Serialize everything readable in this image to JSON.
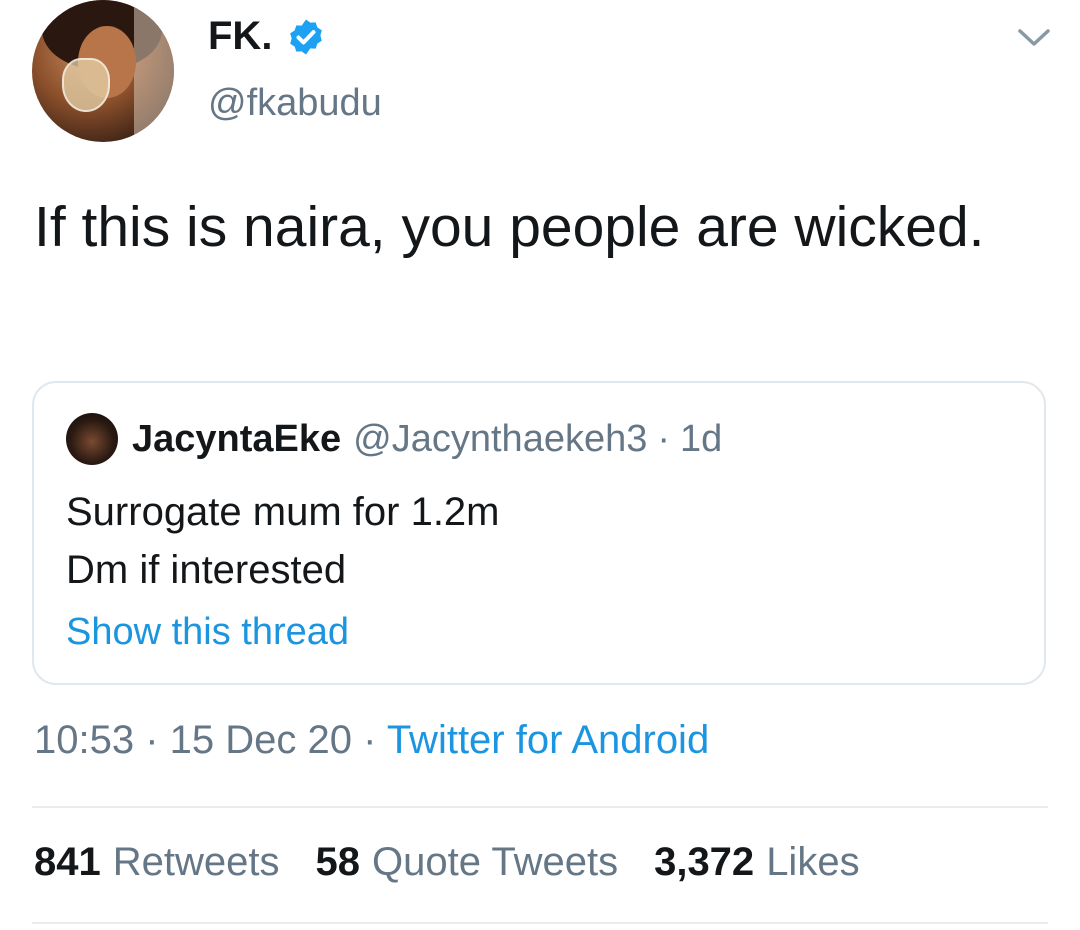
{
  "author": {
    "name": "FK.",
    "handle": "@fkabudu",
    "verified": true
  },
  "tweet": {
    "text": "If this is naira, you people are wicked."
  },
  "quoted_tweet": {
    "name": "JacyntaEke",
    "handle": "@Jacynthaekeh3",
    "separator": "·",
    "time": "1d",
    "lines": [
      "Surrogate mum for 1.2m",
      "Dm if interested"
    ],
    "show_thread": "Show this thread"
  },
  "meta": {
    "time": "10:53",
    "separator1": " · ",
    "date": "15 Dec 20",
    "separator2": " · ",
    "source": "Twitter for Android"
  },
  "stats": {
    "retweets_count": "841",
    "retweets_label": "Retweets",
    "quotes_count": "58",
    "quotes_label": "Quote Tweets",
    "likes_count": "3,372",
    "likes_label": "Likes"
  },
  "colors": {
    "accent": "#1b95e0",
    "secondary_text": "#657786",
    "primary_text": "#14171a",
    "border": "#e1e8ed"
  }
}
